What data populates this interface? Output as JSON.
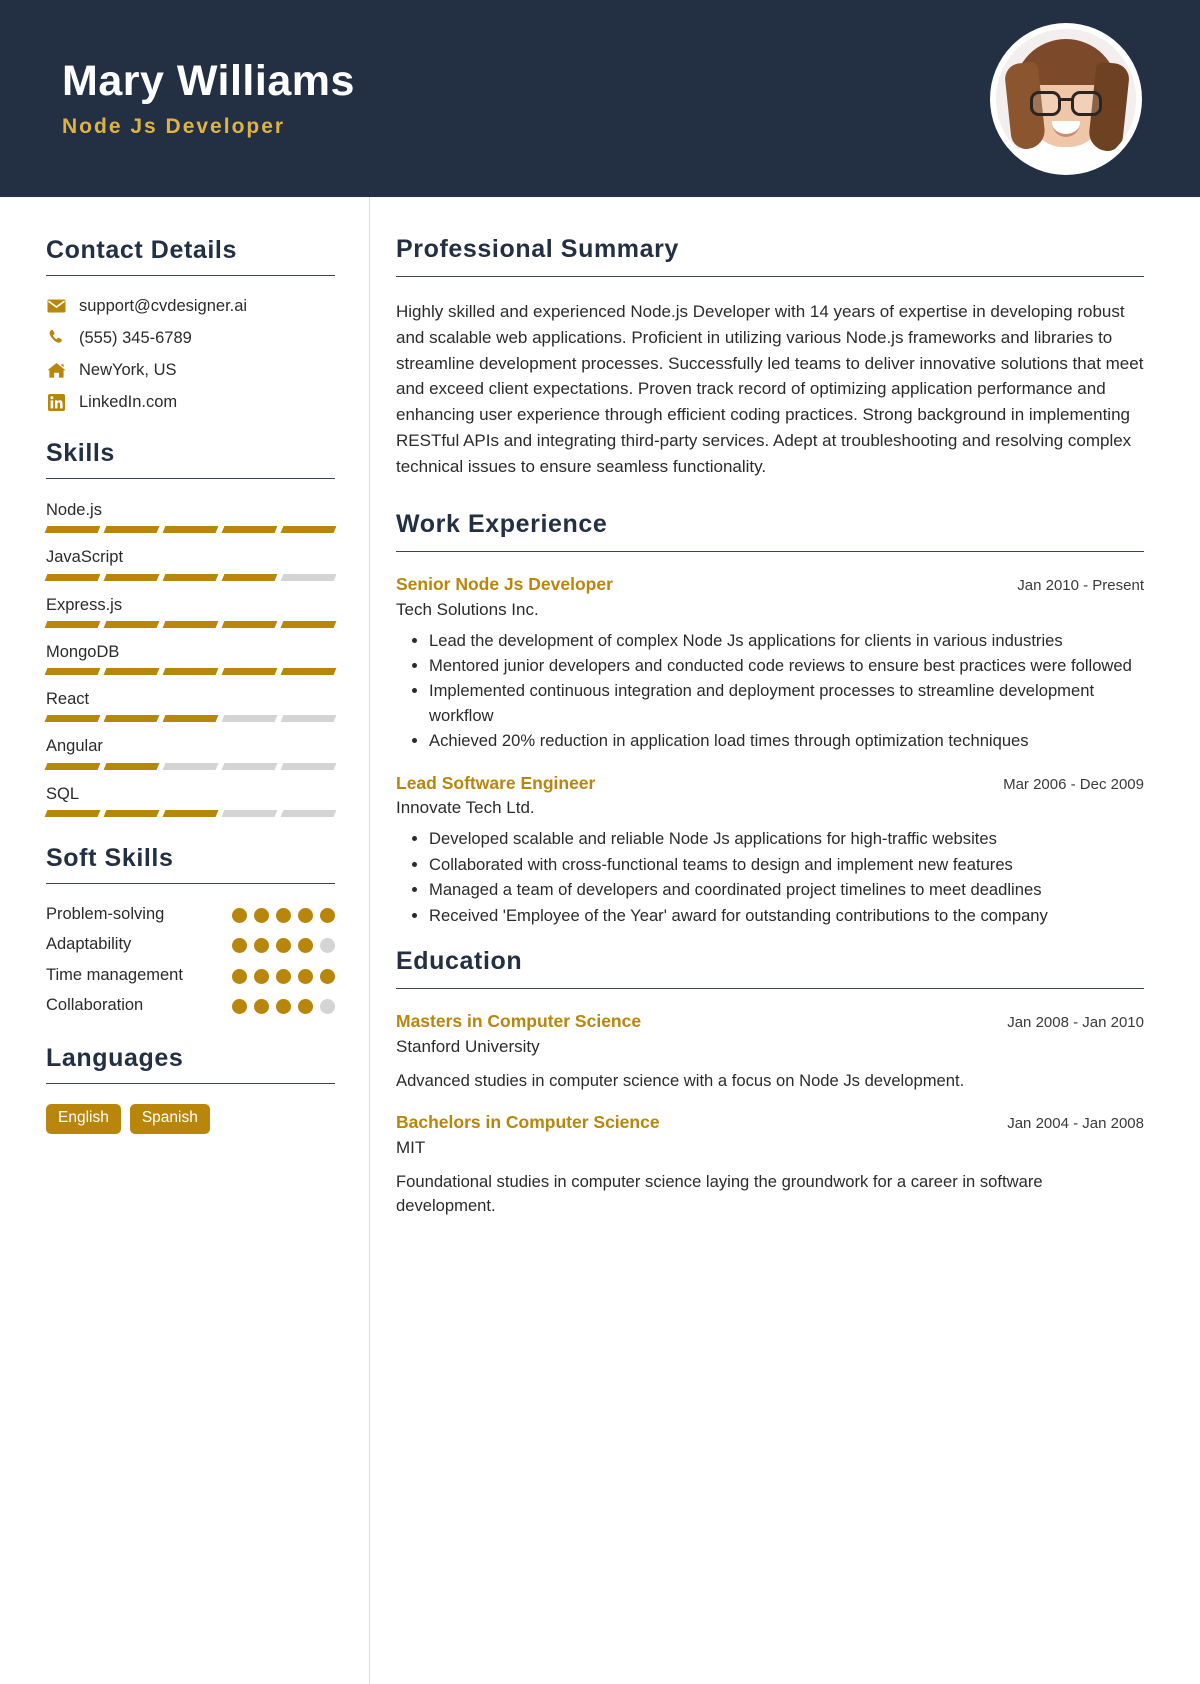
{
  "header": {
    "name": "Mary Williams",
    "role": "Node Js Developer",
    "avatar_icon": "user-photo"
  },
  "sidebar": {
    "contact": {
      "title": "Contact Details",
      "items": [
        {
          "icon": "envelope-icon",
          "text": "support@cvdesigner.ai"
        },
        {
          "icon": "phone-icon",
          "text": "(555) 345-6789"
        },
        {
          "icon": "home-icon",
          "text": "NewYork, US"
        },
        {
          "icon": "linkedin-icon",
          "text": "LinkedIn.com"
        }
      ]
    },
    "skills": {
      "title": "Skills",
      "max": 5,
      "items": [
        {
          "name": "Node.js",
          "level": 5
        },
        {
          "name": "JavaScript",
          "level": 4
        },
        {
          "name": "Express.js",
          "level": 5
        },
        {
          "name": "MongoDB",
          "level": 5
        },
        {
          "name": "React",
          "level": 3
        },
        {
          "name": "Angular",
          "level": 2
        },
        {
          "name": "SQL",
          "level": 3
        }
      ]
    },
    "soft_skills": {
      "title": "Soft Skills",
      "max": 5,
      "items": [
        {
          "name": "Problem-solving",
          "level": 5
        },
        {
          "name": "Adaptability",
          "level": 4
        },
        {
          "name": "Time management",
          "level": 5
        },
        {
          "name": "Collaboration",
          "level": 4
        }
      ]
    },
    "languages": {
      "title": "Languages",
      "items": [
        "English",
        "Spanish"
      ]
    }
  },
  "main": {
    "summary": {
      "title": "Professional Summary",
      "text": "Highly skilled and experienced Node.js Developer with 14 years of expertise in developing robust and scalable web applications. Proficient in utilizing various Node.js frameworks and libraries to streamline development processes. Successfully led teams to deliver innovative solutions that meet and exceed client expectations. Proven track record of optimizing application performance and enhancing user experience through efficient coding practices. Strong background in implementing RESTful APIs and integrating third-party services. Adept at troubleshooting and resolving complex technical issues to ensure seamless functionality."
    },
    "work": {
      "title": "Work Experience",
      "entries": [
        {
          "title": "Senior Node Js Developer",
          "date": "Jan 2010 - Present",
          "org": "Tech Solutions Inc.",
          "bullets": [
            "Lead the development of complex Node Js applications for clients in various industries",
            "Mentored junior developers and conducted code reviews to ensure best practices were followed",
            "Implemented continuous integration and deployment processes to streamline development workflow",
            "Achieved 20% reduction in application load times through optimization techniques"
          ]
        },
        {
          "title": "Lead Software Engineer",
          "date": "Mar 2006 - Dec 2009",
          "org": "Innovate Tech Ltd.",
          "bullets": [
            "Developed scalable and reliable Node Js applications for high-traffic websites",
            "Collaborated with cross-functional teams to design and implement new features",
            "Managed a team of developers and coordinated project timelines to meet deadlines",
            "Received 'Employee of the Year' award for outstanding contributions to the company"
          ]
        }
      ]
    },
    "education": {
      "title": "Education",
      "entries": [
        {
          "title": "Masters in Computer Science",
          "date": "Jan 2008 - Jan 2010",
          "org": "Stanford University",
          "description": "Advanced studies in computer science with a focus on Node Js development."
        },
        {
          "title": "Bachelors in Computer Science",
          "date": "Jan 2004 - Jan 2008",
          "org": "MIT",
          "description": "Foundational studies in computer science laying the groundwork for a career in software development."
        }
      ]
    }
  },
  "colors": {
    "header_bg": "#232f42",
    "accent_gold": "#b8860b",
    "header_role_gold": "#e0b244",
    "heading_navy": "#232f42",
    "muted_track": "#d4d4d4"
  }
}
